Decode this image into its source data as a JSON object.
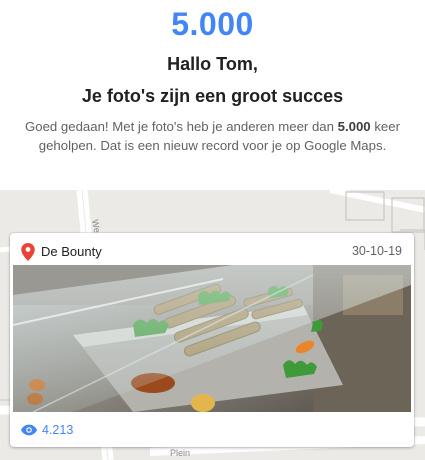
{
  "header": {
    "big_number": "5.000",
    "greeting": "Hallo Tom,",
    "headline": "Je foto's zijn een groot succes",
    "body_prefix": "Goed gedaan! Met je foto's heb je anderen meer dan ",
    "body_bold": "5.000",
    "body_suffix": " keer geholpen. Dat is een nieuw record voor je op Google Maps."
  },
  "map": {
    "street_labels": [
      "We",
      "Plein"
    ]
  },
  "card": {
    "place_name": "De Bounty",
    "date": "30-10-19",
    "view_count": "4.213"
  },
  "icons": {
    "pin": "location-pin-icon",
    "eye": "eye-icon"
  },
  "colors": {
    "accent_blue": "#4285f4",
    "pin_red": "#ea4335",
    "text_dark": "#202124",
    "text_gray": "#5f6368",
    "map_bg": "#eceae6"
  }
}
